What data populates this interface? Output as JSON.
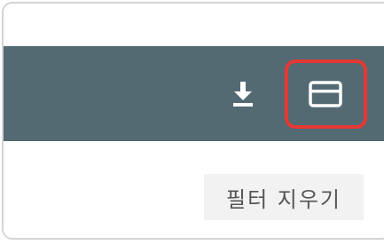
{
  "toolbar": {
    "background_color": "#536a73",
    "download_icon": "download-icon",
    "panel_icon": "panel-toggle-icon",
    "highlight_color": "#e53935"
  },
  "filter": {
    "clear_label": "필터 지우기"
  }
}
